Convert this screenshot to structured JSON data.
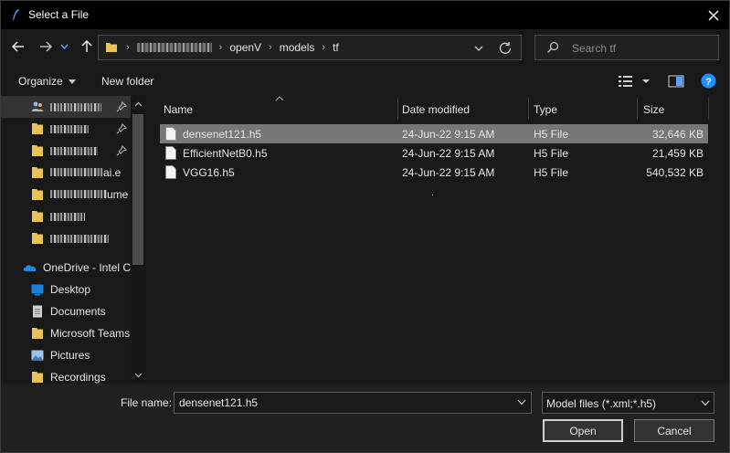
{
  "window": {
    "title": "Select a File"
  },
  "address": {
    "crumbs": [
      "openV",
      "models",
      "tf"
    ],
    "search_placeholder": "Search tf"
  },
  "toolbar": {
    "organize": "Organize",
    "new_folder": "New folder"
  },
  "sidebar": {
    "items": [
      {
        "label": "OneDrive - Intel C",
        "icon": "onedrive-icon"
      },
      {
        "label": "Desktop",
        "icon": "desktop-icon"
      },
      {
        "label": "Documents",
        "icon": "documents-icon"
      },
      {
        "label": "Microsoft Teams",
        "icon": "folder-icon"
      },
      {
        "label": "Pictures",
        "icon": "pictures-icon"
      },
      {
        "label": "Recordings",
        "icon": "folder-icon"
      }
    ],
    "partial_label": "ai.e",
    "partial_label2": "ume"
  },
  "columns": {
    "name": "Name",
    "date": "Date modified",
    "type": "Type",
    "size": "Size"
  },
  "files": [
    {
      "name": "densenet121.h5",
      "date": "24-Jun-22 9:15 AM",
      "type": "H5 File",
      "size": "32,646 KB",
      "selected": true
    },
    {
      "name": "EfficientNetB0.h5",
      "date": "24-Jun-22 9:15 AM",
      "type": "H5 File",
      "size": "21,459 KB",
      "selected": false
    },
    {
      "name": "VGG16.h5",
      "date": "24-Jun-22 9:15 AM",
      "type": "H5 File",
      "size": "540,532 KB",
      "selected": false
    }
  ],
  "bottom": {
    "file_name_label": "File name:",
    "file_name_value": "densenet121.h5",
    "filter": "Model files (*.xml;*.h5)",
    "open": "Open",
    "cancel": "Cancel"
  },
  "colors": {
    "selection": "#777777",
    "folder": "#e8c35a",
    "accent": "#1e90ff"
  }
}
